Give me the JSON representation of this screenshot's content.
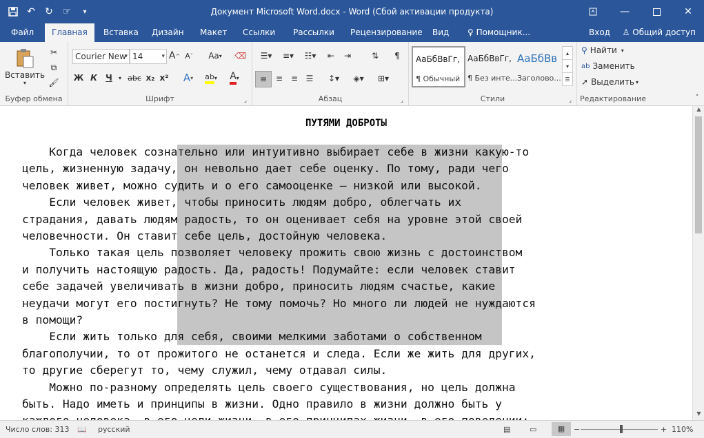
{
  "window": {
    "title": "Документ Microsoft Word.docx - Word (Сбой активации продукта)",
    "qat_icons": [
      "save-icon",
      "undo-icon",
      "redo-icon",
      "touch-mode-icon",
      "customize-icon"
    ],
    "controls": [
      "ribbon-display-icon",
      "minimize-icon",
      "maximize-icon",
      "close-icon"
    ]
  },
  "tabs": {
    "file": "Файл",
    "home": "Главная",
    "insert": "Вставка",
    "design": "Дизайн",
    "layout": "Макет",
    "references": "Ссылки",
    "mailings": "Рассылки",
    "review": "Рецензирование",
    "view": "Вид",
    "tell_me": "Помощник...",
    "signin": "Вход",
    "share": "Общий доступ"
  },
  "ribbon": {
    "clipboard": {
      "label": "Буфер обмена",
      "paste": "Вставить"
    },
    "font": {
      "label": "Шрифт",
      "font_name": "Courier New",
      "font_size": "14",
      "bold": "Ж",
      "italic": "К",
      "underline": "Ч",
      "strike": "abc",
      "subscript": "x₂",
      "superscript": "x²",
      "grow": "A",
      "shrink": "A",
      "case": "Aa",
      "effects": "A",
      "highlight": "ab",
      "color": "A"
    },
    "paragraph": {
      "label": "Абзац"
    },
    "styles": {
      "label": "Стили",
      "items": [
        {
          "sample": "АаБбВвГг,",
          "name": "¶ Обычный"
        },
        {
          "sample": "АаБбВвГг,",
          "name": "¶ Без инте..."
        },
        {
          "sample": "АаБбВв",
          "name": "Заголово..."
        }
      ],
      "heading_color": "#2e74b5"
    },
    "editing": {
      "label": "Редактирование",
      "find": "Найти",
      "replace": "Заменить",
      "select": "Выделить"
    }
  },
  "document": {
    "title": "ПУТЯМИ ДОБРОТЫ",
    "lines": [
      "    Когда человек сознательно или интуитивно выбирает себе в жизни какую-то",
      "цель, жизненную задачу, он невольно дает себе оценку. По тому, ради чего",
      "человек живет, можно судить и о его самооценке – низкой или высокой.",
      "    Если человек живет, чтобы приносить людям добро, облегчать их",
      "страдания, давать людям радость, то он оценивает себя на уровне этой своей",
      "человечности. Он ставит себе цель, достойную человека.",
      "    Только такая цель позволяет человеку прожить свою жизнь с достоинством",
      "и получить настоящую радость. Да, радость! Подумайте: если человек ставит",
      "себе задачей увеличивать в жизни добро, приносить людям счастье, какие",
      "неудачи могут его постигнуть? Не тому помочь? Но много ли людей не нуждаются",
      "в помощи?",
      "    Если жить только для себя, своими мелкими заботами о собственном",
      "благополучии, то от прожитого не останется и следа. Если же жить для других,",
      "то другие сберегут то, чему служил, чему отдавал силы.",
      "    Можно по-разному определять цель своего существования, но цель должна",
      "быть. Надо иметь и принципы в жизни. Одно правило в жизни должно быть у",
      "каждого человека, в его цели жизни, в его принципах жизни, в его поведении:"
    ]
  },
  "statusbar": {
    "word_count": "Число слов: 313",
    "language": "русский",
    "zoom": "110%",
    "zoom_level_percent": 110
  },
  "colors": {
    "brand": "#2b579a",
    "selection": "#c5c5c5"
  }
}
